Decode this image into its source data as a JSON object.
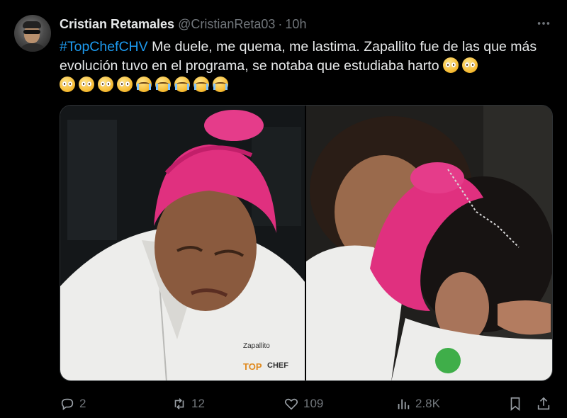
{
  "author": {
    "display_name": "Cristian Retamales",
    "handle": "@CristianReta03",
    "separator": "·",
    "time": "10h"
  },
  "tweet": {
    "hashtag": "#TopChefCHV",
    "text": " Me duele, me quema, me lastima. Zapallito fue de las que más evolución tuvo en el programa, se notaba que estudiaba harto",
    "emojis_inline": [
      "pleading-face",
      "pleading-face"
    ],
    "emojis_line2": [
      "pleading-face",
      "pleading-face",
      "pleading-face",
      "pleading-face",
      "crying-face",
      "crying-face",
      "crying-face",
      "crying-face",
      "crying-face"
    ]
  },
  "media": {
    "left_photo_texts": [
      "Zapallito",
      "TOP",
      "CHEF"
    ]
  },
  "actions": {
    "reply_count": "2",
    "retweet_count": "12",
    "like_count": "109",
    "views_count": "2.8K"
  },
  "colors": {
    "background": "#000000",
    "text": "#e7e9ea",
    "muted": "#71767b",
    "accent": "#1d9bf0",
    "hair_pink": "#e0307f"
  }
}
